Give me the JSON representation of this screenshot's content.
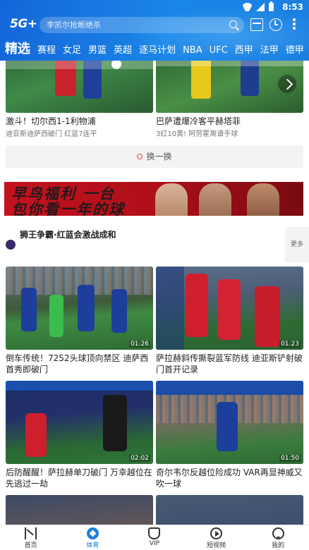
{
  "status_bar": {
    "time": "8:53"
  },
  "header": {
    "logo": "5G+",
    "search": {
      "placeholder": "李凯尔抢断绝杀"
    },
    "tabs": [
      {
        "label": "精选",
        "active": true
      },
      {
        "label": "赛程"
      },
      {
        "label": "女足"
      },
      {
        "label": "男篮"
      },
      {
        "label": "英超"
      },
      {
        "label": "逐马计划"
      },
      {
        "label": "NBA"
      },
      {
        "label": "UFC"
      },
      {
        "label": "西甲"
      },
      {
        "label": "法甲"
      },
      {
        "label": "德甲"
      }
    ]
  },
  "top_cards": [
    {
      "title": "激斗！切尔西1-1利物浦",
      "subtitle": "迪亚斯迪萨西破门 红蓝7连平"
    },
    {
      "title": "巴萨遭爆冷客平赫塔菲",
      "subtitle": "3红10黄! 阿劳霍离谱手球"
    }
  ],
  "refresh": {
    "label": "换一换"
  },
  "banner": {
    "line1": "早鸟福利 一台",
    "line2": "包你看一年的球"
  },
  "section": {
    "title": "狮王争霸·红蓝会激战成和",
    "more": "更多"
  },
  "videos": [
    {
      "title": "倒车传统！7252头球顶向禁区 迪萨西首秀即破门",
      "duration": "01:26"
    },
    {
      "title": "萨拉赫斜传撕裂蓝军防线 迪亚斯铲射破门首开记录",
      "duration": "01:23"
    },
    {
      "title": "后防醒醒！萨拉赫单刀破门 万幸越位在先逃过一劫",
      "duration": "02:02"
    },
    {
      "title": "奇尔韦尔反越位险成功 VAR再显神威又吹一球",
      "duration": "01:50"
    }
  ],
  "bottom_nav": [
    {
      "label": "首页",
      "icon": "home-icon"
    },
    {
      "label": "体育",
      "icon": "sports-icon",
      "active": true
    },
    {
      "label": "VIP",
      "icon": "vip-icon"
    },
    {
      "label": "短视频",
      "icon": "short-video-icon"
    },
    {
      "label": "我的",
      "icon": "mine-icon"
    }
  ],
  "colors": {
    "header": "#1a7fe0",
    "accent": "#1a7fe0",
    "banner": "#c4121f"
  }
}
